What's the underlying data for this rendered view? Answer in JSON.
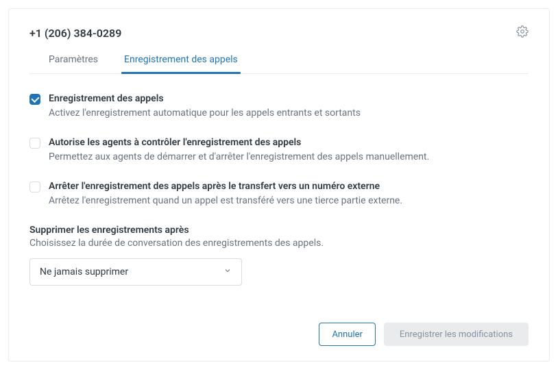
{
  "header": {
    "phone_number": "+1 (206) 384-0289"
  },
  "tabs": [
    {
      "label": "Paramètres",
      "active": false
    },
    {
      "label": "Enregistrement des appels",
      "active": true
    }
  ],
  "options": [
    {
      "checked": true,
      "title": "Enregistrement des appels",
      "desc": "Activez l'enregistrement automatique pour les appels entrants et sortants"
    },
    {
      "checked": false,
      "title": "Autorise les agents à contrôler l'enregistrement des appels",
      "desc": "Permettez aux agents de démarrer et d'arrêter l'enregistrement des appels manuellement."
    },
    {
      "checked": false,
      "title": "Arrêter l'enregistrement des appels après le transfert vers un numéro externe",
      "desc": "Arrêtez l'enregistrement quand un appel est transféré vers une tierce partie externe."
    }
  ],
  "retention": {
    "label": "Supprimer les enregistrements après",
    "desc": "Choisissez la durée de conversation des enregistrements des appels.",
    "selected": "Ne jamais supprimer"
  },
  "footer": {
    "cancel": "Annuler",
    "save": "Enregistrer les modifications"
  }
}
